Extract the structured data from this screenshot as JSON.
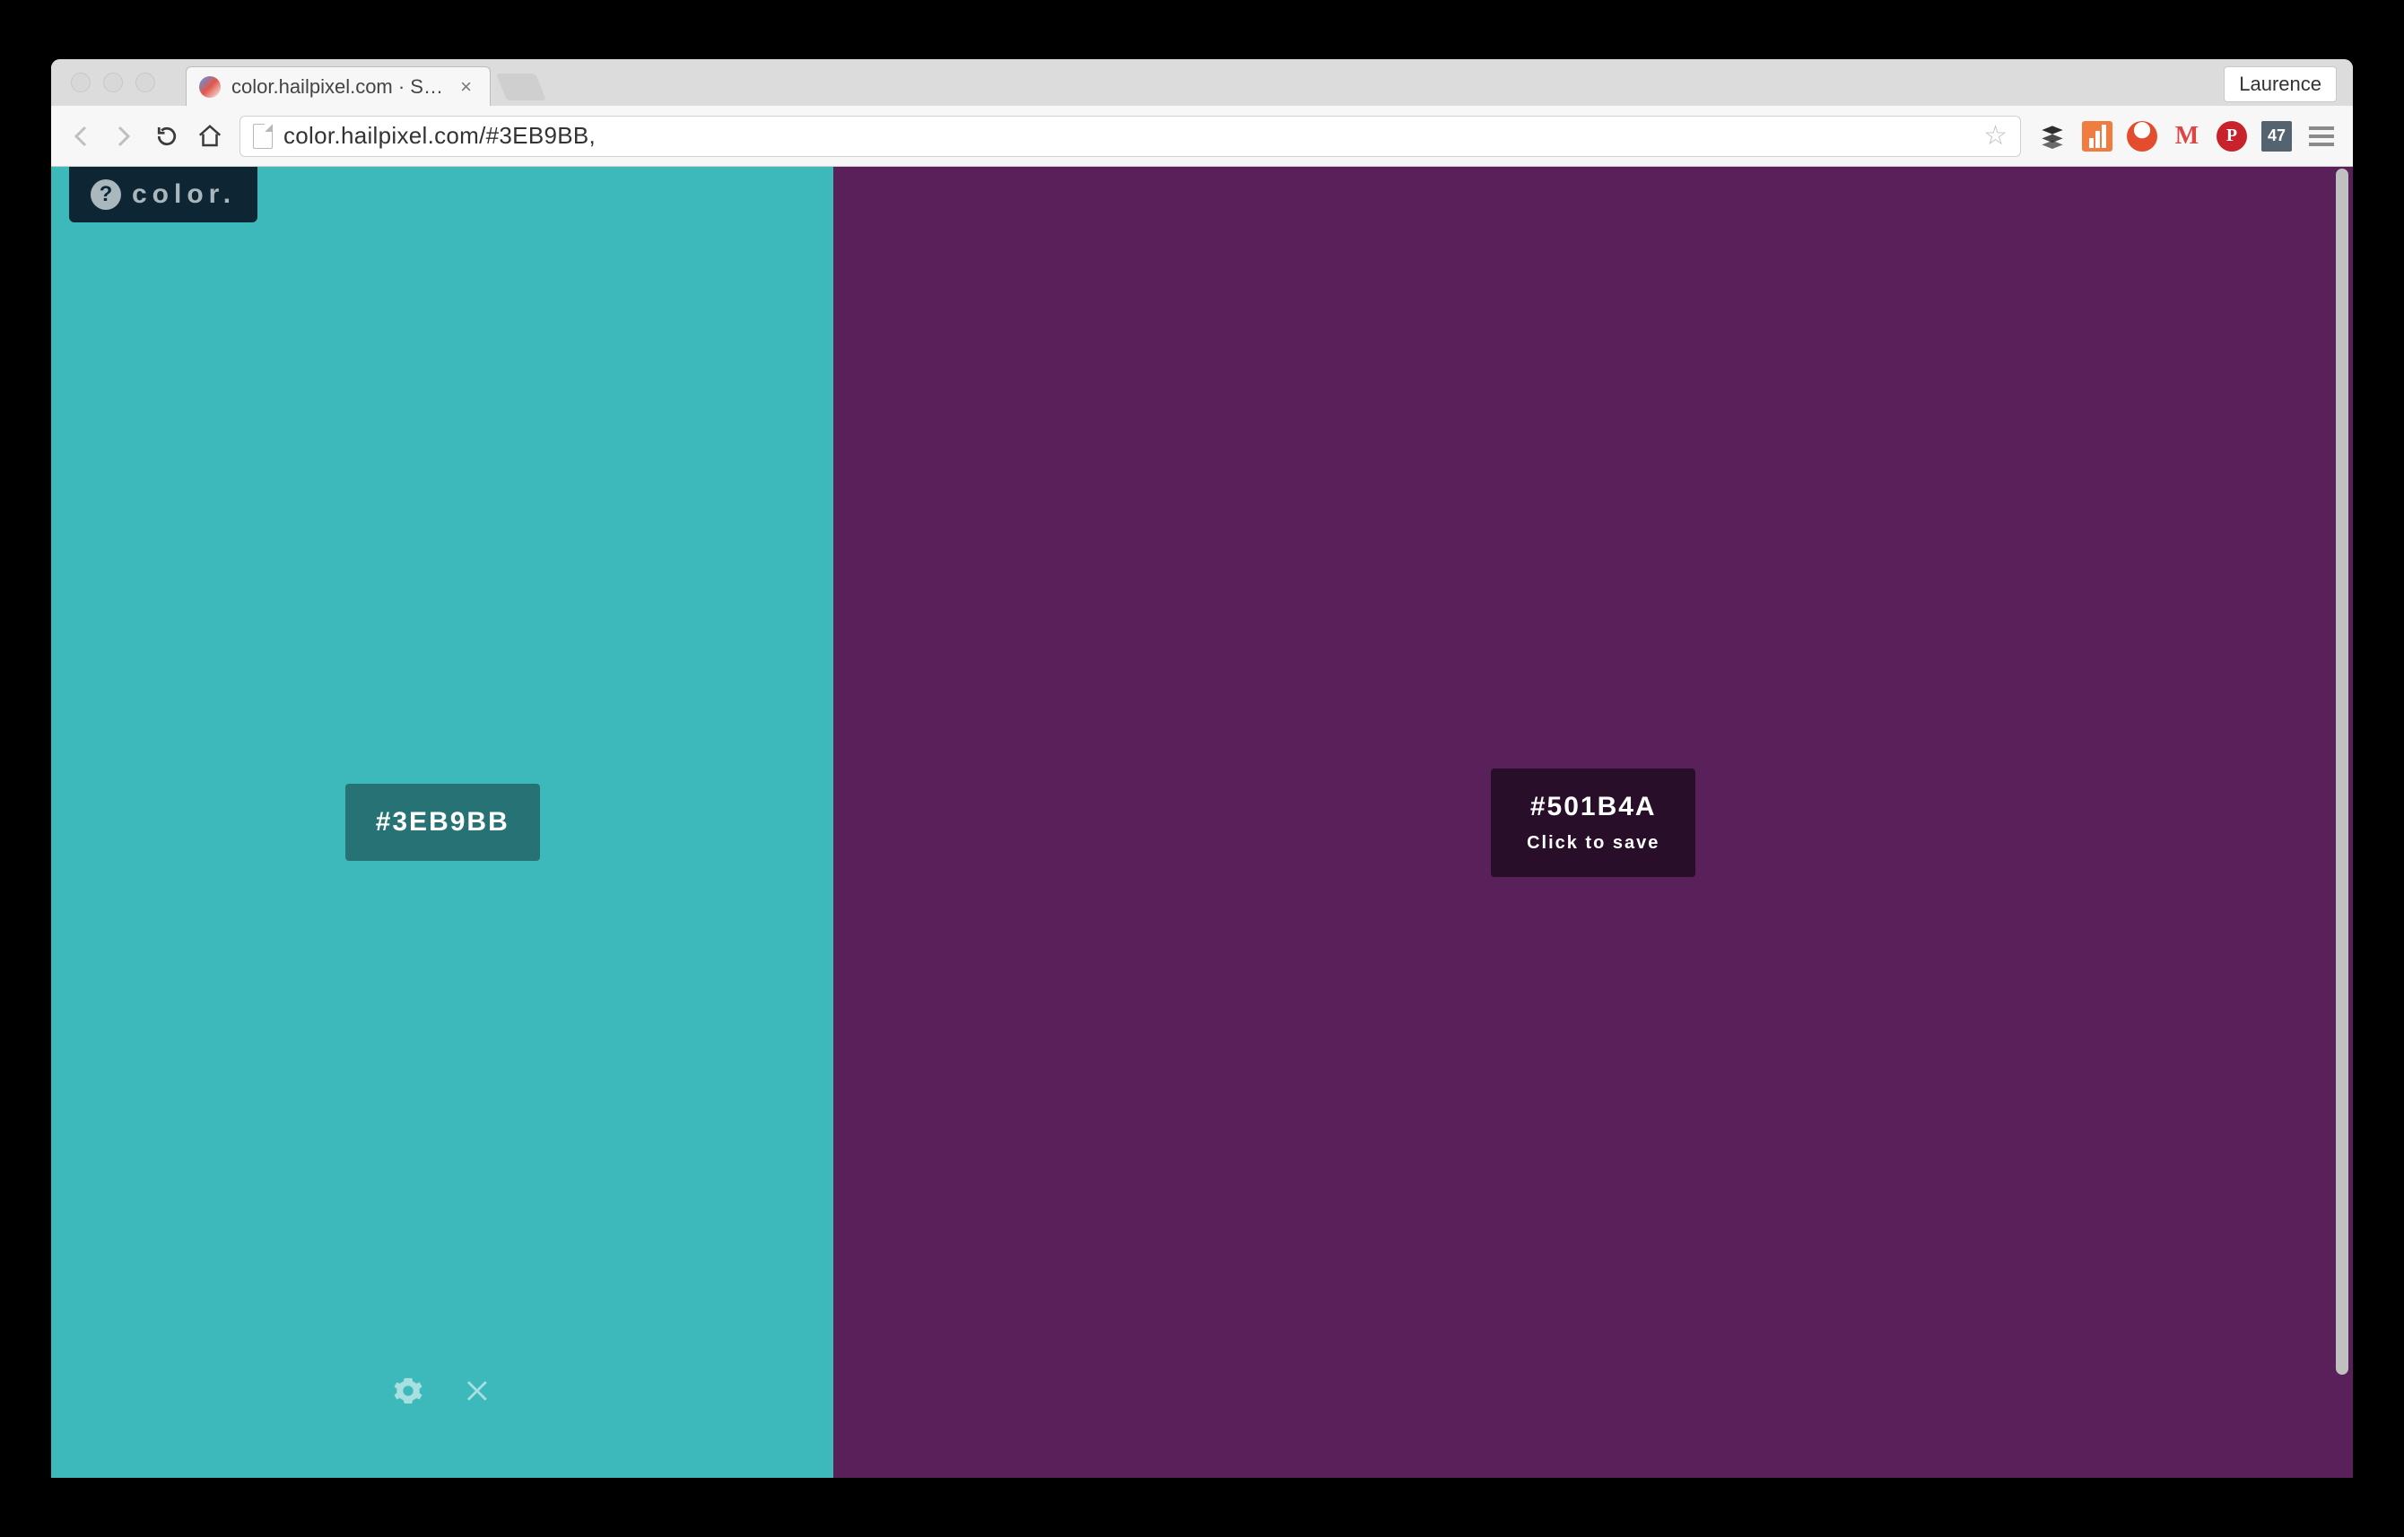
{
  "chrome": {
    "tab_title": "color.hailpixel.com · Swatc",
    "profile_name": "Laurence",
    "url": "color.hailpixel.com/#3EB9BB,",
    "ext_badge_count": "47"
  },
  "site": {
    "badge_label": "color."
  },
  "swatches": {
    "saved": {
      "hex": "#3EB9BB",
      "bg": "#3EB9BB"
    },
    "active": {
      "hex": "#501B4A",
      "bg": "#5A205A",
      "hint": "Click to save"
    }
  }
}
